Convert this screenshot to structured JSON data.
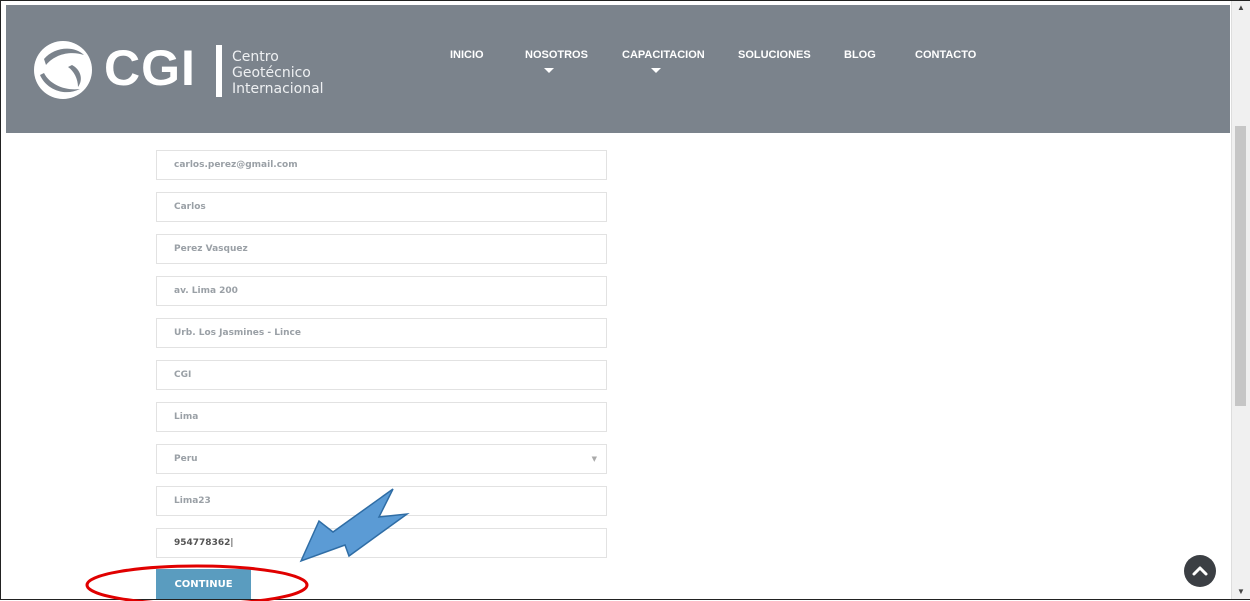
{
  "brand": {
    "logo_text": "CGI",
    "sub_line1": "Centro",
    "sub_line2": "Geotécnico",
    "sub_line3": "Internacional"
  },
  "nav": {
    "items": [
      {
        "label": "INICIO",
        "has_dropdown": false
      },
      {
        "label": "NOSOTROS",
        "has_dropdown": true
      },
      {
        "label": "CAPACITACION",
        "has_dropdown": true
      },
      {
        "label": "SOLUCIONES",
        "has_dropdown": false
      },
      {
        "label": "BLOG",
        "has_dropdown": false
      },
      {
        "label": "CONTACTO",
        "has_dropdown": false
      }
    ]
  },
  "form": {
    "email": "carlos.perez@gmail.com",
    "first_name": "Carlos",
    "last_name": "Perez Vasquez",
    "address_1": "av. Lima 200",
    "address_2": "Urb. Los Jasmines - Lince",
    "company": "CGI",
    "city": "Lima",
    "country": "Peru",
    "postcode": "Lima23",
    "phone": "954778362",
    "continue_label": "CONTINUE"
  },
  "icons": {
    "dropdown_arrow": "▼",
    "scroll_up": "▲",
    "scroll_down": "▼"
  },
  "colors": {
    "header_bg": "#7b838c",
    "button_bg": "#5a9cbf",
    "annotation_arrow": "#5b9bd5",
    "annotation_ellipse": "#e00000"
  }
}
